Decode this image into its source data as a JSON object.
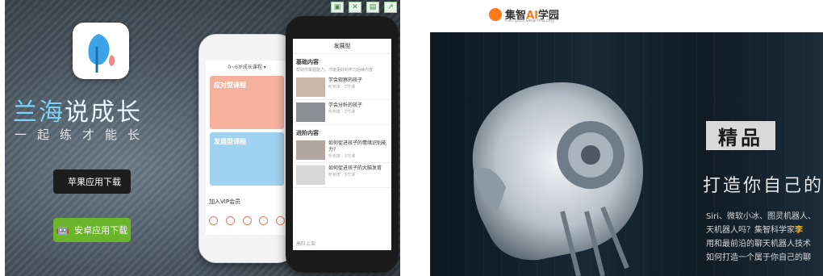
{
  "left_banner": {
    "app_name_part1": "兰海",
    "app_name_part2": "说成长",
    "slogan": "一起练才能长",
    "ios_download": "苹果应用下载",
    "android_download": "安卓应用下载",
    "phone_white": {
      "age_selector": "0~6岁成长课程 ▾",
      "card1_title": "应对型课程",
      "card2_title": "发展型课程",
      "vip_label": "加入VIP会员"
    },
    "phone_black": {
      "header": "发展型",
      "section1": "基础内容",
      "section1_sub": "帮助你掌握能力，才能更好的学习后续内容",
      "items1": [
        "学会观察的孩子",
        "学会分析的孩子"
      ],
      "section2": "进阶内容",
      "items2": [
        "如何促进孩子的情绪识别能力?",
        "如何促进孩子的大脑发育"
      ],
      "meta": "听到率 · 3节课",
      "footer": "高阶上架"
    }
  },
  "right_banner": {
    "brand_name_a": "集智",
    "brand_name_ai": "AI",
    "brand_name_b": "学园",
    "brand_domain": "campus.swarma.org",
    "badge": "精品",
    "headline": "打造你自己的",
    "line1": "Siri、微软小冰、图灵机器人、",
    "line2_a": "天机器人吗？集智科学家",
    "line2_hl": "李",
    "line3": "用和最前沿的聊天机器人技术",
    "line4": "如何打造一个属于你自己的聊"
  },
  "colors": {
    "accent_orange": "#ff7a1a",
    "android_green": "#6ab52a",
    "highlight_gold": "#f2b530"
  }
}
